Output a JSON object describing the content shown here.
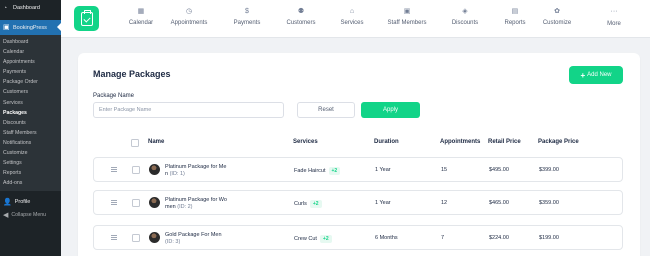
{
  "wp_sidebar": {
    "dashboard": "Dashboard",
    "plugin": "BookingPress",
    "submenu": [
      "Dashboard",
      "Calendar",
      "Appointments",
      "Payments",
      "Package Order",
      "Customers",
      "Services",
      "Packages",
      "Discounts",
      "Staff Members",
      "Notifications",
      "Customize",
      "Settings",
      "Reports",
      "Add-ons"
    ],
    "current_index": 7,
    "profile": "Profile",
    "collapse": "Collapse Menu"
  },
  "topnav": {
    "items": [
      {
        "label": "Calendar",
        "icon": "calendar-icon"
      },
      {
        "label": "Appointments",
        "icon": "appointments-icon"
      },
      {
        "label": "Payments",
        "icon": "payments-icon"
      },
      {
        "label": "Customers",
        "icon": "customers-icon"
      },
      {
        "label": "Services",
        "icon": "services-icon"
      },
      {
        "label": "Staff Members",
        "icon": "staff-members-icon"
      },
      {
        "label": "Discounts",
        "icon": "discounts-icon"
      },
      {
        "label": "Reports",
        "icon": "reports-icon"
      },
      {
        "label": "Customize",
        "icon": "customize-icon"
      },
      {
        "label": "More",
        "icon": "more-icon"
      }
    ]
  },
  "page": {
    "title": "Manage Packages",
    "add_new": "Add New",
    "filter_label": "Package Name",
    "filter_placeholder": "Enter Package Name",
    "filter_value": "",
    "reset": "Reset",
    "apply": "Apply"
  },
  "table": {
    "columns": [
      "Name",
      "Services",
      "Duration",
      "Appointments",
      "Retail Price",
      "Package Price"
    ],
    "rows": [
      {
        "name": "Platinum Package for Me",
        "name2": "n",
        "id": "(ID: 1)",
        "service": "Fade Haircut",
        "extra": "+2",
        "duration": "1 Year",
        "appointments": "15",
        "retail": "$495.00",
        "price": "$399.00"
      },
      {
        "name": "Platinum Package for Wo",
        "name2": "men",
        "id": "(ID: 2)",
        "service": "Curls",
        "extra": "+2",
        "duration": "1 Year",
        "appointments": "12",
        "retail": "$465.00",
        "price": "$359.00"
      },
      {
        "name": "Gold Package For Men",
        "name2": "",
        "id": "(ID: 3)",
        "service": "Crew Cut",
        "extra": "+2",
        "duration": "6 Months",
        "appointments": "7",
        "retail": "$224.00",
        "price": "$199.00"
      }
    ]
  },
  "colors": {
    "accent": "#12d488",
    "wp_active": "#2271b1",
    "wp_sidebar": "#1d2327"
  }
}
